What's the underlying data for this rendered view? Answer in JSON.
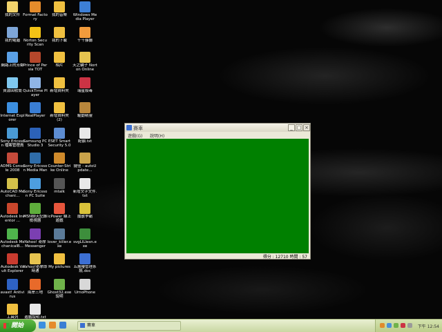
{
  "desktop_icons": [
    {
      "label": "我的文件",
      "color": "#f2d36b"
    },
    {
      "label": "Format Factory",
      "color": "#e58b2b"
    },
    {
      "label": "我的音樂",
      "color": "#f0c040"
    },
    {
      "label": "Windows Media Player",
      "color": "#3d7fd6"
    },
    {
      "label": "我的電腦",
      "color": "#7ea6d8"
    },
    {
      "label": "Norton Security Scan",
      "color": "#f3c316"
    },
    {
      "label": "我的下載",
      "color": "#f0c040"
    },
    {
      "label": "千千靜聽",
      "color": "#f29b3c"
    },
    {
      "label": "網路上的芳鄰",
      "color": "#5aa0e6"
    },
    {
      "label": "Prince of Persia TOT",
      "color": "#b5472b"
    },
    {
      "label": "相片",
      "color": "#f0c040"
    },
    {
      "label": "天之驕子 Norton Online",
      "color": "#e6c34f"
    },
    {
      "label": "資源回收筒",
      "color": "#7fc8ef"
    },
    {
      "label": "QuickTime Player",
      "color": "#8fb5e6"
    },
    {
      "label": "新增資料夾",
      "color": "#f0c040"
    },
    {
      "label": "瑞星殺毒",
      "color": "#cc3344"
    },
    {
      "label": "Internet Explorer",
      "color": "#3c8fe0"
    },
    {
      "label": "RealPlayer",
      "color": "#3a7ed4"
    },
    {
      "label": "新增資料夾 (2)",
      "color": "#f0c040"
    },
    {
      "label": "驅動精靈",
      "color": "#b8863b"
    },
    {
      "label": "Sony Ericsson 檔案管理員",
      "color": "#4a9ad4"
    },
    {
      "label": "Samsung PC Studio 3",
      "color": "#2c62b8"
    },
    {
      "label": "ESET Smart Security 5.0",
      "color": "#5d8dd2"
    },
    {
      "label": "配額.txt",
      "color": "#e8e8e8"
    },
    {
      "label": "ADMS Console 2008",
      "color": "#c44a3a"
    },
    {
      "label": "Sony Ericsson Media Manag...",
      "color": "#2f6ca8"
    },
    {
      "label": "Counter-Strike Online",
      "color": "#cf8a2b"
    },
    {
      "label": "捷徑 - autoUpdate...",
      "color": "#c9a24a"
    },
    {
      "label": "AutoCAD Mechani...",
      "color": "#d4c14a"
    },
    {
      "label": "Sony Ericsson PC Suite",
      "color": "#4d9ee0"
    },
    {
      "label": "mtalk",
      "color": "#555555"
    },
    {
      "label": "新增文字文件.txt",
      "color": "#e8e8e8"
    },
    {
      "label": "Autodesk Inventor ...",
      "color": "#c9462c"
    },
    {
      "label": "MSN聊天記錄檢視器",
      "color": "#5fae3c"
    },
    {
      "label": "icPower 線上遊戲",
      "color": "#e6553c"
    },
    {
      "label": "魔獸爭霸",
      "color": "#d9c23a"
    },
    {
      "label": "Autodesk MechanicalB...",
      "color": "#4fb44c"
    },
    {
      "label": "Yahoo! 奇摩 Messenger",
      "color": "#7b3fb2"
    },
    {
      "label": "lover_killer.exe",
      "color": "#5b7b99"
    },
    {
      "label": "svgLILIesn.exe",
      "color": "#3d8e3c"
    },
    {
      "label": "Autodesk Vault Explorer 2008",
      "color": "#c93b2f"
    },
    {
      "label": "Yahoo!奇摩即時通",
      "color": "#e6c34f"
    },
    {
      "label": "My pictures",
      "color": "#f0c040"
    },
    {
      "label": "五層樓管理系統.doc",
      "color": "#3c6fd4"
    },
    {
      "label": "avast! Antivirus",
      "color": "#2e62c4"
    },
    {
      "label": "兩岸三地",
      "color": "#e86a2a"
    },
    {
      "label": "Ghost32.exe 說明",
      "color": "#6fb34a"
    },
    {
      "label": "UrnoPhone",
      "color": "#d8d8d8"
    },
    {
      "label": "工具列",
      "color": "#f0c040"
    },
    {
      "label": "遊戲說明.txt",
      "color": "#e8e8e8"
    }
  ],
  "window": {
    "title": "賽車",
    "menu": [
      "遊戲(G)",
      "說明(H)"
    ],
    "minimize_label": "_",
    "maximize_label": "□",
    "close_label": "×",
    "status_text": "得分 : 12710 時間 : 57",
    "game_area_color": "#008000"
  },
  "taskbar": {
    "start_label": "開始",
    "active_task_label": "賽車",
    "clock": "下午 12:54"
  }
}
